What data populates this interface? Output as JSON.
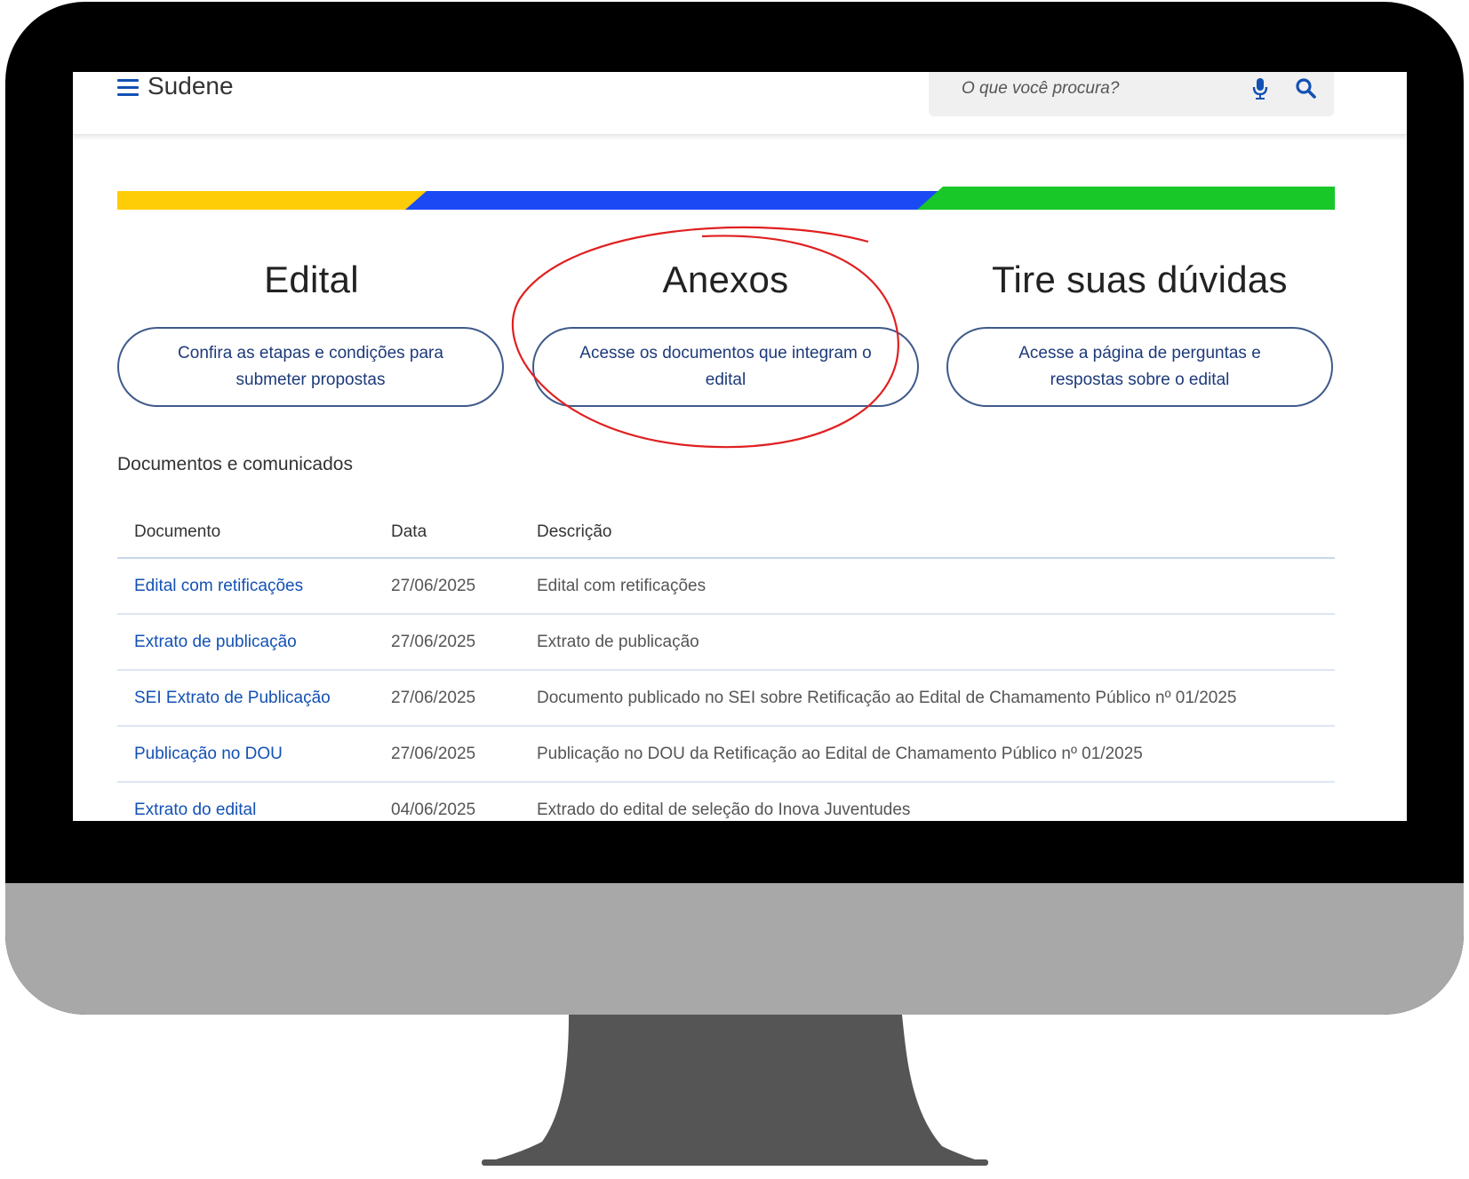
{
  "header": {
    "logo": "Sudene",
    "search_placeholder": "O que você procura?"
  },
  "columns": [
    {
      "title": "Edital",
      "button": [
        "Confira as etapas e condições para",
        "submeter propostas"
      ]
    },
    {
      "title": "Anexos",
      "button": [
        "Acesse os documentos que integram o",
        "edital"
      ]
    },
    {
      "title": "Tire suas dúvidas",
      "button": [
        "Acesse a página de perguntas e",
        "respostas sobre o edital"
      ]
    }
  ],
  "section": {
    "title": "Documentos e comunicados"
  },
  "table": {
    "headers": [
      "Documento",
      "Data",
      "Descrição"
    ],
    "rows": [
      {
        "documento": "Edital com retificações",
        "data": "27/06/2025",
        "descricao": "Edital com retificações"
      },
      {
        "documento": "Extrato de publicação",
        "data": "27/06/2025",
        "descricao": "Extrato de publicação"
      },
      {
        "documento": "SEI Extrato de Publicação",
        "data": "27/06/2025",
        "descricao": "Documento publicado no SEI sobre Retificação ao Edital de Chamamento Público nº 01/2025"
      },
      {
        "documento": "Publicação no DOU",
        "data": "27/06/2025",
        "descricao": "Publicação no DOU da Retificação ao Edital de Chamamento Público nº 01/2025"
      },
      {
        "documento": "Extrato do edital",
        "data": "04/06/2025",
        "descricao": "Extrado do edital de seleção do Inova Juventudes"
      }
    ]
  },
  "colors": {
    "yellow": "#ffcd07",
    "blue": "#1b4af5",
    "green": "#18c728",
    "link": "#1351b4",
    "annotation": "#e02020"
  },
  "icons": [
    "menu-icon",
    "mic-icon",
    "search-icon"
  ]
}
